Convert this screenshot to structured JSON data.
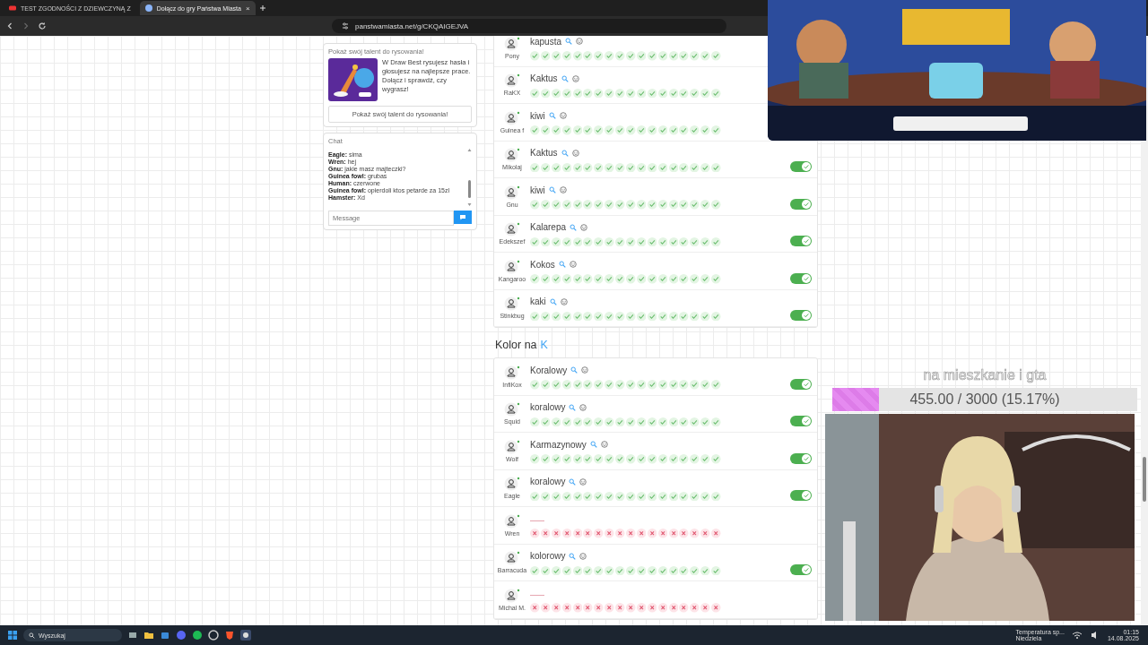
{
  "browser": {
    "tabs": [
      {
        "title": "TEST ZGODNOŚCI Z DZIEWCZYNĄ Z",
        "selected": false
      },
      {
        "title": "Dołącz do gry Państwa Miasta",
        "selected": true,
        "close": "×"
      }
    ],
    "url": "panstwamiasta.net/g/CKQAIGEJVA"
  },
  "ad": {
    "title": "Pokaż swój talent do rysowania!",
    "text": "W Draw Best rysujesz hasła i głosujesz na najlepsze prace. Dołącz i sprawdź, czy wygrasz!",
    "button": "Pokaż swój talent do rysowania!"
  },
  "chat": {
    "title": "Chat",
    "messages": [
      "**Eagle:** sima",
      "**Wren:** hej",
      "**Gnu:** jakie masz majteczki?",
      "**Guinea fowl:** grubas",
      "**Human:** czerwone",
      "**Guinea fowl:** opierdoli ktos petarde za 15zl",
      "**Hamster:** Xd"
    ],
    "placeholder": "Message"
  },
  "sections": [
    {
      "rows": [
        {
          "player": "Pony",
          "kind": "valid",
          "answer": "kapusta",
          "votes": [
            true,
            true,
            true,
            true,
            true,
            true,
            true,
            true,
            true,
            true,
            true,
            true,
            true,
            true,
            true,
            true,
            true,
            true
          ]
        },
        {
          "player": "RaKX",
          "kind": "valid",
          "answer": "Kaktus",
          "votes": [
            true,
            true,
            true,
            true,
            true,
            true,
            true,
            true,
            true,
            true,
            true,
            true,
            true,
            true,
            true,
            true,
            true,
            true
          ]
        },
        {
          "player": "Guinea f",
          "kind": "valid",
          "answer": "kiwi",
          "votes": [
            true,
            true,
            true,
            true,
            true,
            true,
            true,
            true,
            true,
            true,
            true,
            true,
            true,
            true,
            true,
            true,
            true,
            true
          ]
        },
        {
          "player": "Mikolaj",
          "kind": "valid",
          "answer": "Kaktus",
          "accepted": true,
          "votes": [
            true,
            true,
            true,
            true,
            true,
            true,
            true,
            true,
            true,
            true,
            true,
            true,
            true,
            true,
            true,
            true,
            true,
            true
          ]
        },
        {
          "player": "Gnu",
          "kind": "valid",
          "answer": "kiwi",
          "accepted": true,
          "votes": [
            true,
            true,
            true,
            true,
            true,
            true,
            true,
            true,
            true,
            true,
            true,
            true,
            true,
            true,
            true,
            true,
            true,
            true
          ]
        },
        {
          "player": "Edekszef",
          "kind": "valid",
          "answer": "Kalarepa",
          "accepted": true,
          "votes": [
            true,
            true,
            true,
            true,
            true,
            true,
            true,
            true,
            true,
            true,
            true,
            true,
            true,
            true,
            true,
            true,
            true,
            true
          ]
        },
        {
          "player": "Kangaroo",
          "kind": "valid",
          "answer": "Kokos",
          "accepted": true,
          "votes": [
            true,
            true,
            true,
            true,
            true,
            true,
            true,
            true,
            true,
            true,
            true,
            true,
            true,
            true,
            true,
            true,
            true,
            true
          ]
        },
        {
          "player": "Stinkbug",
          "kind": "valid",
          "answer": "kaki",
          "accepted": true,
          "votes": [
            true,
            true,
            true,
            true,
            true,
            true,
            true,
            true,
            true,
            true,
            true,
            true,
            true,
            true,
            true,
            true,
            true,
            true
          ]
        }
      ]
    },
    {
      "title": "Kolor na",
      "letter": "K",
      "rows": [
        {
          "player": "InfiKox",
          "kind": "valid",
          "answer": "Koralowy",
          "accepted": true,
          "votes": [
            true,
            true,
            true,
            true,
            true,
            true,
            true,
            true,
            true,
            true,
            true,
            true,
            true,
            true,
            true,
            true,
            true,
            true
          ]
        },
        {
          "player": "Squid",
          "kind": "valid",
          "answer": "koralowy",
          "accepted": true,
          "votes": [
            true,
            true,
            true,
            true,
            true,
            true,
            true,
            true,
            true,
            true,
            true,
            true,
            true,
            true,
            true,
            true,
            true,
            true
          ]
        },
        {
          "player": "Wolf",
          "kind": "valid",
          "answer": "Karmazynowy",
          "accepted": true,
          "votes": [
            true,
            true,
            true,
            true,
            true,
            true,
            true,
            true,
            true,
            true,
            true,
            true,
            true,
            true,
            true,
            true,
            true,
            true
          ]
        },
        {
          "player": "Eagle",
          "kind": "valid",
          "answer": "koralowy",
          "accepted": true,
          "votes": [
            true,
            true,
            true,
            true,
            true,
            true,
            true,
            true,
            true,
            true,
            true,
            true,
            true,
            true,
            true,
            true,
            true,
            true
          ]
        },
        {
          "player": "Wren",
          "kind": "empty",
          "votes": [
            false,
            false,
            false,
            false,
            false,
            false,
            false,
            false,
            false,
            false,
            false,
            false,
            false,
            false,
            false,
            false,
            false,
            false
          ]
        },
        {
          "player": "Barracuda",
          "kind": "valid",
          "answer": "kolorowy",
          "accepted": true,
          "votes": [
            true,
            true,
            true,
            true,
            true,
            true,
            true,
            true,
            true,
            true,
            true,
            true,
            true,
            true,
            true,
            true,
            true,
            true
          ]
        },
        {
          "player": "Michal M.",
          "kind": "empty",
          "votes": [
            false,
            false,
            false,
            false,
            false,
            false,
            false,
            false,
            false,
            false,
            false,
            false,
            false,
            false,
            false,
            false,
            false,
            false
          ]
        }
      ]
    }
  ],
  "stream": {
    "goal": {
      "title": "na mieszkanie i gta",
      "level": 0.1517,
      "reading": "455.00 / 3000 (15.17%)"
    }
  },
  "taskbar": {
    "search": "Wyszukaj",
    "weather": "Temperatura sp...",
    "day": "Niedziela",
    "time": "01:15",
    "date": "14.08.2025"
  }
}
